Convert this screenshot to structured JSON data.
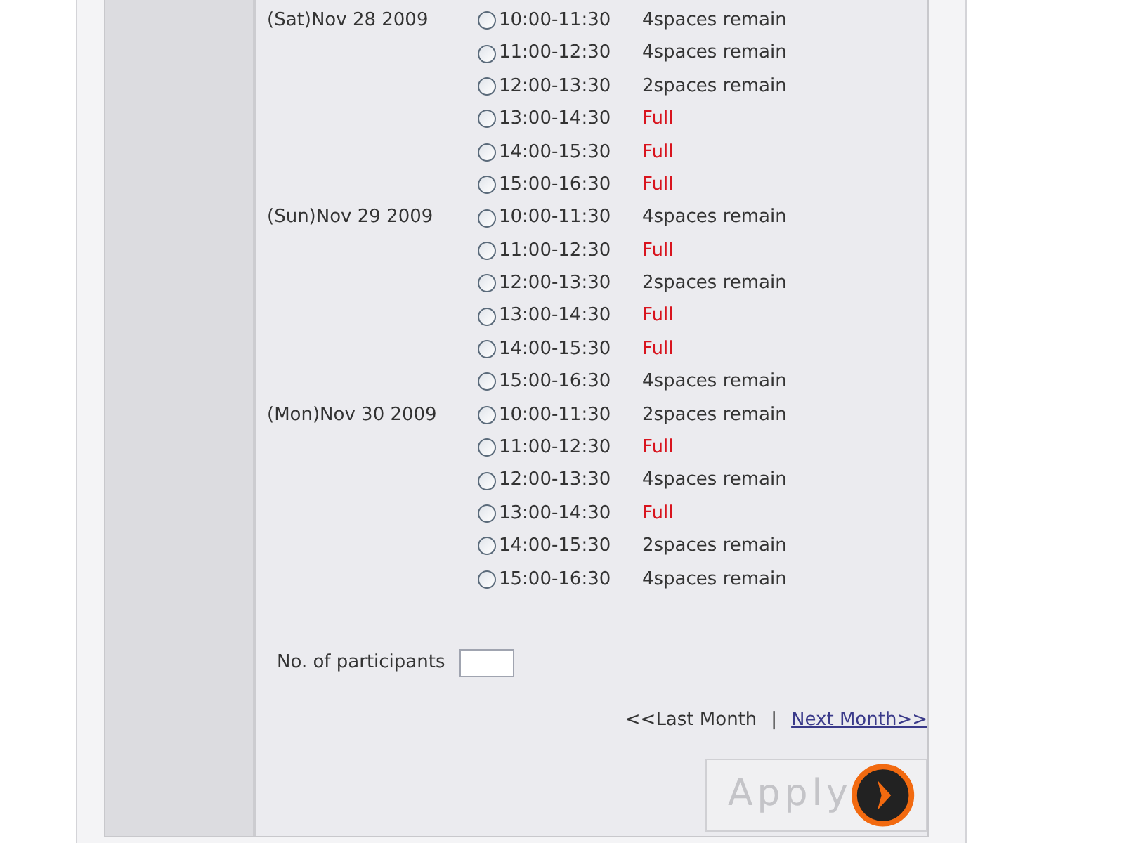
{
  "days": [
    {
      "date": "(Sat)Nov 28 2009",
      "slots": [
        {
          "time": "10:00-11:30",
          "status": "4spaces remain",
          "kind": "open",
          "selected": false
        },
        {
          "time": "11:00-12:30",
          "status": "4spaces remain",
          "kind": "open",
          "selected": false
        },
        {
          "time": "12:00-13:30",
          "status": "2spaces remain",
          "kind": "open",
          "selected": false
        },
        {
          "time": "13:00-14:30",
          "status": "Full",
          "kind": "full",
          "selected": false
        },
        {
          "time": "14:00-15:30",
          "status": "Full",
          "kind": "full",
          "selected": false
        },
        {
          "time": "15:00-16:30",
          "status": "Full",
          "kind": "full",
          "selected": false
        }
      ]
    },
    {
      "date": "(Sun)Nov 29 2009",
      "slots": [
        {
          "time": "10:00-11:30",
          "status": "4spaces remain",
          "kind": "open",
          "selected": false
        },
        {
          "time": "11:00-12:30",
          "status": "Full",
          "kind": "full",
          "selected": false
        },
        {
          "time": "12:00-13:30",
          "status": "2spaces remain",
          "kind": "open",
          "selected": false
        },
        {
          "time": "13:00-14:30",
          "status": "Full",
          "kind": "full",
          "selected": false
        },
        {
          "time": "14:00-15:30",
          "status": "Full",
          "kind": "full",
          "selected": false
        },
        {
          "time": "15:00-16:30",
          "status": "4spaces remain",
          "kind": "open",
          "selected": false
        }
      ]
    },
    {
      "date": "(Mon)Nov 30 2009",
      "slots": [
        {
          "time": "10:00-11:30",
          "status": "2spaces remain",
          "kind": "open",
          "selected": false
        },
        {
          "time": "11:00-12:30",
          "status": "Full",
          "kind": "full",
          "selected": false
        },
        {
          "time": "12:00-13:30",
          "status": "4spaces remain",
          "kind": "open",
          "selected": false
        },
        {
          "time": "13:00-14:30",
          "status": "Full",
          "kind": "full",
          "selected": false
        },
        {
          "time": "14:00-15:30",
          "status": "2spaces remain",
          "kind": "open",
          "selected": false
        },
        {
          "time": "15:00-16:30",
          "status": "4spaces remain",
          "kind": "open",
          "selected": false
        }
      ]
    }
  ],
  "participants": {
    "label": "No. of participants"
  },
  "nav": {
    "prev": "<<Last Month",
    "separator": "|",
    "next": "Next Month>>"
  },
  "apply": {
    "label": "Apply"
  }
}
